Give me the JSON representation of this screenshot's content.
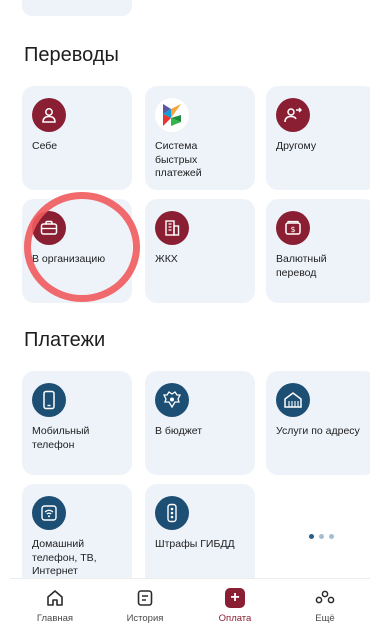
{
  "sections": {
    "transfers_title": "Переводы",
    "payments_title": "Платежи"
  },
  "transfers": [
    {
      "label": "Себе",
      "icon": "person-icon"
    },
    {
      "label": "Система быстрых платежей",
      "icon": "sbp-logo-icon"
    },
    {
      "label": "Другому",
      "icon": "person-send-icon"
    },
    {
      "label": "В организацию",
      "icon": "briefcase-icon"
    },
    {
      "label": "ЖКХ",
      "icon": "building-icon"
    },
    {
      "label": "Валютный перевод",
      "icon": "currency-note-icon"
    }
  ],
  "payments": [
    {
      "label": "Мобильный телефон",
      "icon": "smartphone-icon"
    },
    {
      "label": "В бюджет",
      "icon": "state-emblem-icon"
    },
    {
      "label": "Услуги по адресу",
      "icon": "house-icon"
    },
    {
      "label": "Домашний телефон, ТВ, Интернет",
      "icon": "wifi-icon"
    },
    {
      "label": "Штрафы ГИБДД",
      "icon": "traffic-light-icon"
    }
  ],
  "pager": {
    "count": 3,
    "active": 0
  },
  "tabbar": [
    {
      "label": "Главная",
      "icon": "home-icon"
    },
    {
      "label": "История",
      "icon": "history-icon"
    },
    {
      "label": "Оплата",
      "icon": "payment-plus-icon",
      "active": true
    },
    {
      "label": "Ещё",
      "icon": "more-icon"
    }
  ],
  "colors": {
    "accent": "#8a1e33",
    "payment_icon_bg": "#1d4f74",
    "tile_bg": "#eef3fa",
    "highlight": "#ef5a5c"
  }
}
